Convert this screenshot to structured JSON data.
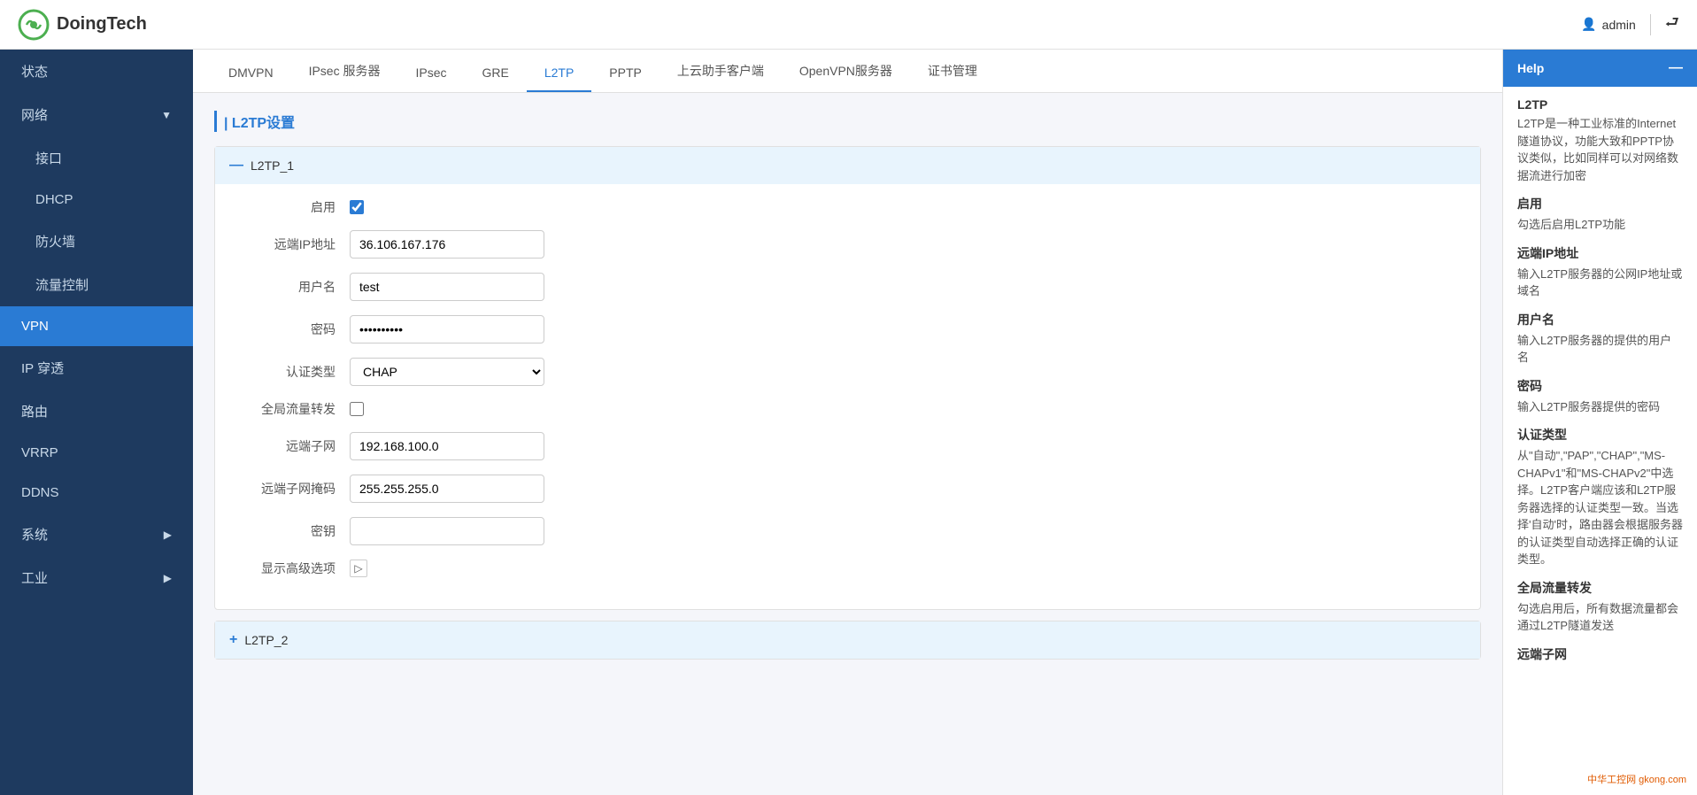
{
  "header": {
    "logo_text": "DoingTech",
    "user_icon": "👤",
    "username": "admin",
    "logout_icon": "⮐"
  },
  "sidebar": {
    "items": [
      {
        "label": "状态",
        "active": false,
        "has_arrow": false,
        "name": "sidebar-item-status"
      },
      {
        "label": "网络",
        "active": false,
        "has_arrow": true,
        "name": "sidebar-item-network"
      },
      {
        "label": "接口",
        "active": false,
        "has_arrow": false,
        "name": "sidebar-item-interface",
        "indent": true
      },
      {
        "label": "DHCP",
        "active": false,
        "has_arrow": false,
        "name": "sidebar-item-dhcp",
        "indent": true
      },
      {
        "label": "防火墙",
        "active": false,
        "has_arrow": false,
        "name": "sidebar-item-firewall",
        "indent": true
      },
      {
        "label": "流量控制",
        "active": false,
        "has_arrow": false,
        "name": "sidebar-item-traffic",
        "indent": true
      },
      {
        "label": "VPN",
        "active": true,
        "has_arrow": false,
        "name": "sidebar-item-vpn"
      },
      {
        "label": "IP 穿透",
        "active": false,
        "has_arrow": false,
        "name": "sidebar-item-ip-tunnel"
      },
      {
        "label": "路由",
        "active": false,
        "has_arrow": false,
        "name": "sidebar-item-route"
      },
      {
        "label": "VRRP",
        "active": false,
        "has_arrow": false,
        "name": "sidebar-item-vrrp"
      },
      {
        "label": "DDNS",
        "active": false,
        "has_arrow": false,
        "name": "sidebar-item-ddns"
      },
      {
        "label": "系统",
        "active": false,
        "has_arrow": true,
        "name": "sidebar-item-system"
      },
      {
        "label": "工业",
        "active": false,
        "has_arrow": true,
        "name": "sidebar-item-industrial"
      }
    ]
  },
  "tabs": {
    "items": [
      {
        "label": "DMVPN",
        "active": false,
        "name": "tab-dmvpn"
      },
      {
        "label": "IPsec 服务器",
        "active": false,
        "name": "tab-ipsec-server"
      },
      {
        "label": "IPsec",
        "active": false,
        "name": "tab-ipsec"
      },
      {
        "label": "GRE",
        "active": false,
        "name": "tab-gre"
      },
      {
        "label": "L2TP",
        "active": true,
        "name": "tab-l2tp"
      },
      {
        "label": "PPTP",
        "active": false,
        "name": "tab-pptp"
      },
      {
        "label": "上云助手客户端",
        "active": false,
        "name": "tab-cloud-client"
      },
      {
        "label": "OpenVPN服务器",
        "active": false,
        "name": "tab-openvpn"
      }
    ],
    "cert_label": "证书管理"
  },
  "page": {
    "section_title": "| L2TP设置",
    "l2tp_1": {
      "header_label": "L2TP_1",
      "enable_label": "启用",
      "enable_checked": true,
      "remote_ip_label": "远端IP地址",
      "remote_ip_value": "36.106.167.176",
      "remote_ip_placeholder": "36.106.167.176",
      "username_label": "用户名",
      "username_value": "test",
      "password_label": "密码",
      "password_value": "••••••••••",
      "auth_type_label": "认证类型",
      "auth_type_value": "CHAP",
      "auth_type_options": [
        "自动",
        "PAP",
        "CHAP",
        "MS-CHAPv1",
        "MS-CHAPv2"
      ],
      "global_forward_label": "全局流量转发",
      "global_forward_checked": false,
      "remote_subnet_label": "远端子网",
      "remote_subnet_value": "192.168.100.0",
      "remote_mask_label": "远端子网掩码",
      "remote_mask_value": "255.255.255.0",
      "key_label": "密钥",
      "key_value": "",
      "show_advanced_label": "显示高级选项"
    },
    "l2tp_2": {
      "header_label": "L2TP_2"
    }
  },
  "help": {
    "title": "Help",
    "close_label": "—",
    "sections": [
      {
        "title": "L2TP",
        "text": "L2TP是一种工业标准的Internet隧道协议，功能大致和PPTP协议类似，比如同样可以对网络数据流进行加密"
      },
      {
        "title": "启用",
        "text": "勾选后启用L2TP功能"
      },
      {
        "title": "远端IP地址",
        "text": "输入L2TP服务器的公网IP地址或域名"
      },
      {
        "title": "用户名",
        "text": "输入L2TP服务器的提供的用户名"
      },
      {
        "title": "密码",
        "text": "输入L2TP服务器提供的密码"
      },
      {
        "title": "认证类型",
        "text": "从\"自动\",\"PAP\",\"CHAP\",\"MS-CHAPv1\"和\"MS-CHAPv2\"中选择。L2TP客户端应该和L2TP服务器选择的认证类型一致。当选择'自动'时，路由器会根据服务器的认证类型自动选择正确的认证类型。"
      },
      {
        "title": "全局流量转发",
        "text": "勾选启用后，所有数据流量都会通过L2TP隧道发送"
      },
      {
        "title": "远端子网",
        "text": ""
      }
    ]
  }
}
